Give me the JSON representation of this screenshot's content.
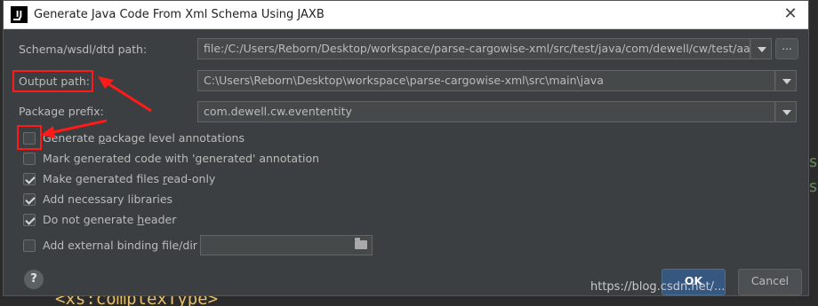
{
  "dialog": {
    "title": "Generate Java Code From Xml Schema Using JAXB",
    "app_icon_text": "IJ",
    "close_glyph": "✕"
  },
  "form": {
    "schema_label": "Schema/wsdl/dtd path:",
    "schema_value": "file:/C:/Users/Reborn/Desktop/workspace/parse-cargowise-xml/src/test/java/com/dewell/cw/test/aa.xsd",
    "schema_browse_label": "...",
    "output_label": "Output path:",
    "output_value": "C:\\Users\\Reborn\\Desktop\\workspace\\parse-cargowise-xml\\src\\main\\java",
    "package_label": "Package prefix:",
    "package_value": "com.dewell.cw.evententity"
  },
  "options": [
    {
      "pre": "Generate ",
      "ul": "p",
      "post": "ackage level annotations",
      "checked": false
    },
    {
      "pre": "Mark generated code with 'generated' annotation",
      "ul": "",
      "post": "",
      "checked": false
    },
    {
      "pre": "Make generated files ",
      "ul": "r",
      "post": "ead-only",
      "checked": true
    },
    {
      "pre": "Add necessary libraries",
      "ul": "",
      "post": "",
      "checked": true
    },
    {
      "pre": "Do not generate ",
      "ul": "h",
      "post": "eader",
      "checked": true
    }
  ],
  "binding": {
    "label": "Add external binding file/dir",
    "checked": false,
    "value": ""
  },
  "buttons": {
    "help": "?",
    "ok": "OK",
    "cancel": "Cancel"
  },
  "editor": {
    "code_line": "<xs:complexType>",
    "edge_char": "s"
  },
  "watermark": "https://blog.csdn.net/...",
  "colors": {
    "dialog_bg": "#3c3f41",
    "field_bg": "#45494a",
    "ok_bg": "#365880",
    "annotation_red": "#ff1a1a"
  }
}
